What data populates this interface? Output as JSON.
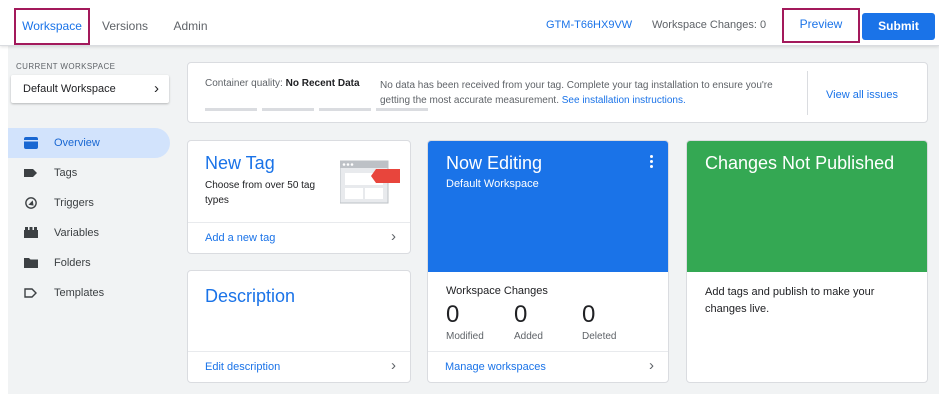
{
  "header": {
    "tabs": [
      {
        "label": "Workspace"
      },
      {
        "label": "Versions"
      },
      {
        "label": "Admin"
      }
    ],
    "container_id": "GTM-T66HX9VW",
    "workspace_changes": "Workspace Changes: 0",
    "preview_label": "Preview",
    "submit_label": "Submit"
  },
  "sidebar": {
    "current_workspace_label": "CURRENT WORKSPACE",
    "workspace_name": "Default Workspace",
    "items": [
      {
        "label": "Overview",
        "icon": "overview-icon"
      },
      {
        "label": "Tags",
        "icon": "tag-icon"
      },
      {
        "label": "Triggers",
        "icon": "trigger-icon"
      },
      {
        "label": "Variables",
        "icon": "variables-icon"
      },
      {
        "label": "Folders",
        "icon": "folder-icon"
      },
      {
        "label": "Templates",
        "icon": "template-icon"
      }
    ]
  },
  "quality": {
    "label": "Container quality:",
    "value": "No Recent Data",
    "message": "No data has been received from your tag. Complete your tag installation to ensure you're getting the most accurate measurement.",
    "link": "See installation instructions.",
    "issues_link": "View all issues"
  },
  "new_tag": {
    "title": "New Tag",
    "description": "Choose from over 50 tag types",
    "link": "Add a new tag"
  },
  "description_card": {
    "title": "Description",
    "link": "Edit description"
  },
  "now_editing": {
    "title": "Now Editing",
    "workspace": "Default Workspace",
    "changes_label": "Workspace Changes",
    "stats": [
      {
        "value": "0",
        "label": "Modified"
      },
      {
        "value": "0",
        "label": "Added"
      },
      {
        "value": "0",
        "label": "Deleted"
      }
    ],
    "link": "Manage workspaces"
  },
  "not_published": {
    "title": "Changes Not Published",
    "message": "Add tags and publish to make your changes live."
  },
  "colors": {
    "accent": "#1a73e8",
    "green": "#34a853",
    "highlight": "#a3195b"
  }
}
